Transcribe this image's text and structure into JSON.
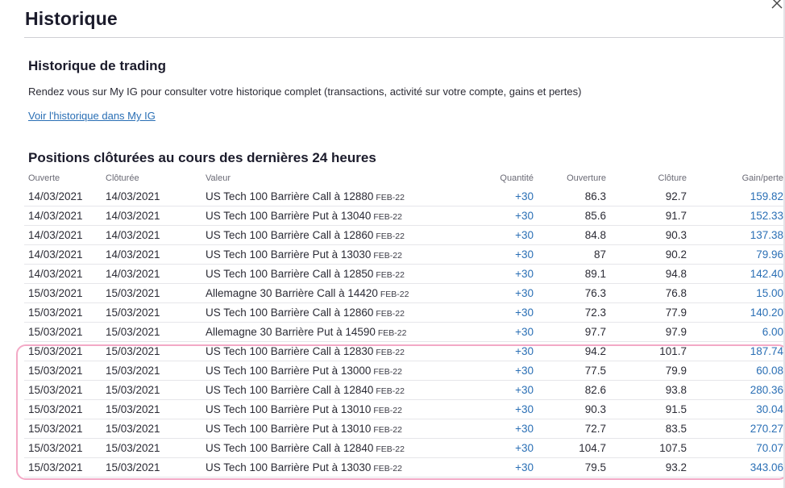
{
  "modal": {
    "title": "Historique",
    "close_icon": "close-icon"
  },
  "trading_history": {
    "title": "Historique de trading",
    "description": "Rendez vous sur My IG pour consulter votre historique complet (transactions, activité sur votre compte, gains et pertes)",
    "link_text": "Voir l'historique dans My IG"
  },
  "closed_positions": {
    "title": "Positions clôturées au cours des dernières 24 heures",
    "headers": {
      "opened": "Ouverte",
      "closed": "Clôturée",
      "value": "Valeur",
      "quantity": "Quantité",
      "open_price": "Ouverture",
      "close_price": "Clôture",
      "pl": "Gain/perte"
    },
    "rows": [
      {
        "opened": "14/03/2021",
        "closed": "14/03/2021",
        "instrument": "US Tech 100 Barrière Call à 12880",
        "expiry": "FEB-22",
        "qty": "+30",
        "open": "86.3",
        "close": "92.7",
        "pl": "159.82"
      },
      {
        "opened": "14/03/2021",
        "closed": "14/03/2021",
        "instrument": "US Tech 100 Barrière Put à 13040",
        "expiry": "FEB-22",
        "qty": "+30",
        "open": "85.6",
        "close": "91.7",
        "pl": "152.33"
      },
      {
        "opened": "14/03/2021",
        "closed": "14/03/2021",
        "instrument": "US Tech 100 Barrière Call à 12860",
        "expiry": "FEB-22",
        "qty": "+30",
        "open": "84.8",
        "close": "90.3",
        "pl": "137.38"
      },
      {
        "opened": "14/03/2021",
        "closed": "14/03/2021",
        "instrument": "US Tech 100 Barrière Put à 13030",
        "expiry": "FEB-22",
        "qty": "+30",
        "open": "87",
        "close": "90.2",
        "pl": "79.96"
      },
      {
        "opened": "14/03/2021",
        "closed": "14/03/2021",
        "instrument": "US Tech 100 Barrière Call à 12850",
        "expiry": "FEB-22",
        "qty": "+30",
        "open": "89.1",
        "close": "94.8",
        "pl": "142.40"
      },
      {
        "opened": "15/03/2021",
        "closed": "15/03/2021",
        "instrument": "Allemagne 30 Barrière Call à 14420",
        "expiry": "FEB-22",
        "qty": "+30",
        "open": "76.3",
        "close": "76.8",
        "pl": "15.00"
      },
      {
        "opened": "15/03/2021",
        "closed": "15/03/2021",
        "instrument": "US Tech 100 Barrière Call à 12860",
        "expiry": "FEB-22",
        "qty": "+30",
        "open": "72.3",
        "close": "77.9",
        "pl": "140.20"
      },
      {
        "opened": "15/03/2021",
        "closed": "15/03/2021",
        "instrument": "Allemagne 30 Barrière Put à 14590",
        "expiry": "FEB-22",
        "qty": "+30",
        "open": "97.7",
        "close": "97.9",
        "pl": "6.00"
      },
      {
        "opened": "15/03/2021",
        "closed": "15/03/2021",
        "instrument": "US Tech 100 Barrière Call à 12830",
        "expiry": "FEB-22",
        "qty": "+30",
        "open": "94.2",
        "close": "101.7",
        "pl": "187.74"
      },
      {
        "opened": "15/03/2021",
        "closed": "15/03/2021",
        "instrument": "US Tech 100 Barrière Put à 13000",
        "expiry": "FEB-22",
        "qty": "+30",
        "open": "77.5",
        "close": "79.9",
        "pl": "60.08"
      },
      {
        "opened": "15/03/2021",
        "closed": "15/03/2021",
        "instrument": "US Tech 100 Barrière Call à 12840",
        "expiry": "FEB-22",
        "qty": "+30",
        "open": "82.6",
        "close": "93.8",
        "pl": "280.36"
      },
      {
        "opened": "15/03/2021",
        "closed": "15/03/2021",
        "instrument": "US Tech 100 Barrière Put à 13010",
        "expiry": "FEB-22",
        "qty": "+30",
        "open": "90.3",
        "close": "91.5",
        "pl": "30.04"
      },
      {
        "opened": "15/03/2021",
        "closed": "15/03/2021",
        "instrument": "US Tech 100 Barrière Put à 13010",
        "expiry": "FEB-22",
        "qty": "+30",
        "open": "72.7",
        "close": "83.5",
        "pl": "270.27"
      },
      {
        "opened": "15/03/2021",
        "closed": "15/03/2021",
        "instrument": "US Tech 100 Barrière Call à 12840",
        "expiry": "FEB-22",
        "qty": "+30",
        "open": "104.7",
        "close": "107.5",
        "pl": "70.07"
      },
      {
        "opened": "15/03/2021",
        "closed": "15/03/2021",
        "instrument": "US Tech 100 Barrière Put à 13030",
        "expiry": "FEB-22",
        "qty": "+30",
        "open": "79.5",
        "close": "93.2",
        "pl": "343.06"
      }
    ]
  },
  "colors": {
    "link": "#2a6fb5",
    "highlight_border": "#f3a9c6",
    "text": "#1b1b2b"
  }
}
